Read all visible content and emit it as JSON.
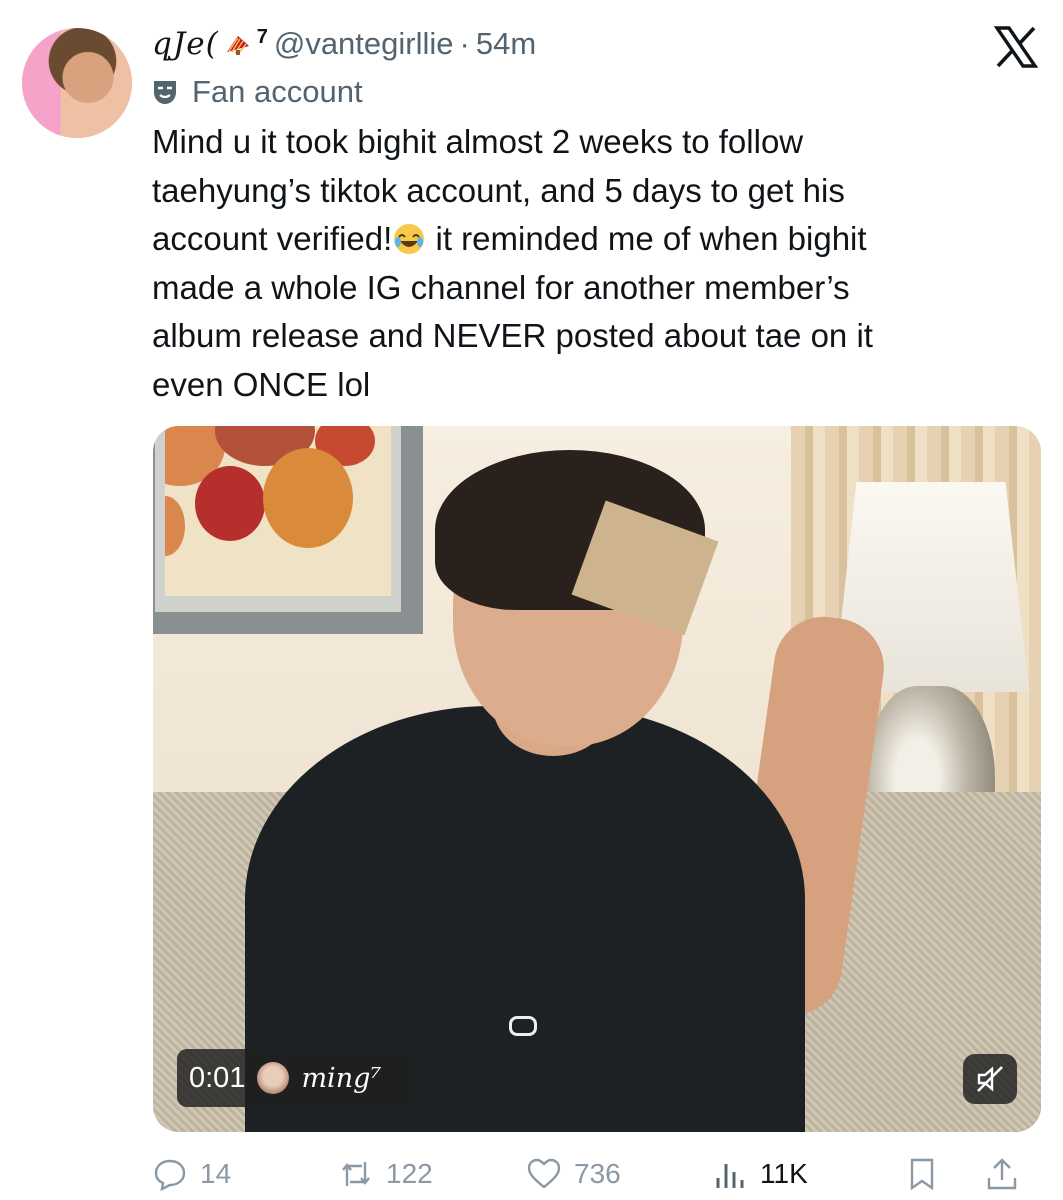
{
  "author": {
    "display_name": "qJe(",
    "badge_number": "7",
    "handle": "@vantegirllie",
    "separator": "·",
    "time": "54m",
    "affiliation_label": "Fan account"
  },
  "tweet": {
    "text_part1": "Mind u it took bighit almost 2 weeks to follow\ntaehyung’s tiktok account, and 5 days to get his\naccount verified!",
    "text_part2": " it reminded me of when bighit\nmade a whole IG channel for another member’s\nalbum release and NEVER posted about tae on it\neven ONCE lol"
  },
  "media": {
    "timestamp": "0:01",
    "watermark": "ming⁷",
    "muted": true
  },
  "actions": {
    "replies": "14",
    "reposts": "122",
    "likes": "736",
    "views": "11K"
  },
  "icons": [
    "fan-fan-icon",
    "masks-icon",
    "x-logo-icon",
    "laughing-emoji-icon",
    "mute-icon",
    "reply-icon",
    "repost-icon",
    "like-icon",
    "views-icon",
    "bookmark-icon",
    "share-icon"
  ]
}
